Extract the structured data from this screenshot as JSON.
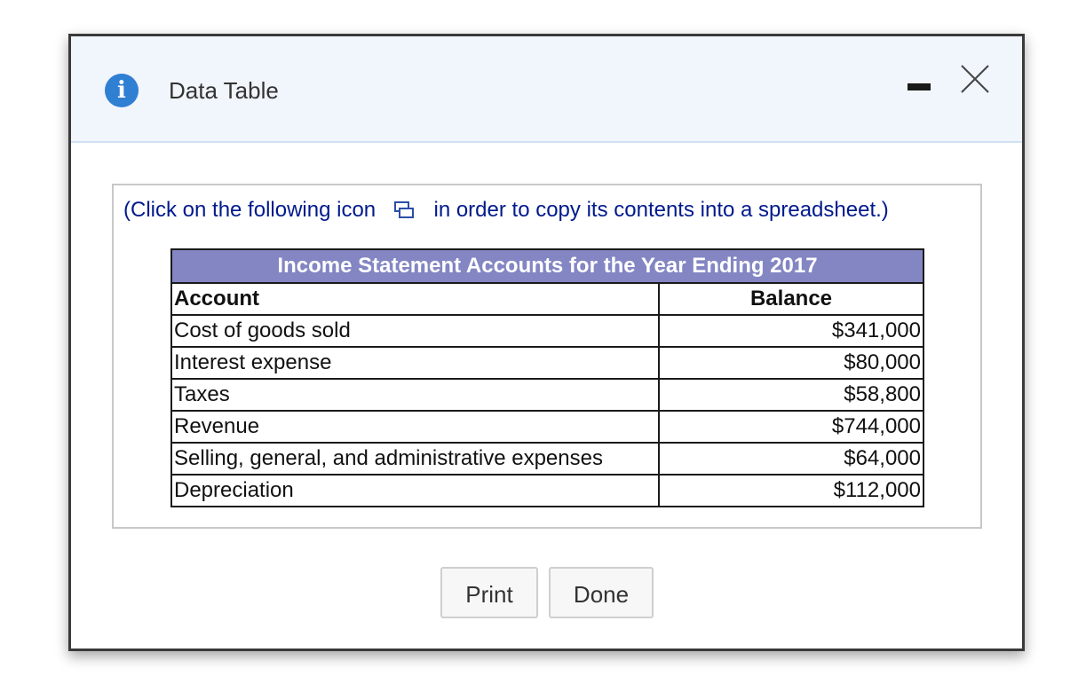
{
  "dialog": {
    "title": "Data Table",
    "icons": {
      "info": "info-icon",
      "info_glyph": "i",
      "minimize": "minimize-icon",
      "close": "close-icon",
      "copy": "copy-icon"
    }
  },
  "instruction": {
    "before_icon": "(Click on the following icon",
    "after_icon": "in order to copy its contents into a spreadsheet.)"
  },
  "table": {
    "caption": "Income Statement Accounts for the Year Ending 2017",
    "headers": {
      "account": "Account",
      "balance": "Balance"
    },
    "rows": [
      {
        "account": "Cost of goods sold",
        "balance": "$341,000"
      },
      {
        "account": "Interest expense",
        "balance": "$80,000"
      },
      {
        "account": "Taxes",
        "balance": "$58,800"
      },
      {
        "account": "Revenue",
        "balance": "$744,000"
      },
      {
        "account": "Selling, general, and administrative expenses",
        "balance": "$64,000"
      },
      {
        "account": "Depreciation",
        "balance": "$112,000"
      }
    ],
    "caption_color": "#8386c3"
  },
  "buttons": {
    "print_label": "Print",
    "done_label": "Done"
  },
  "colors": {
    "accent": "#2f7fd3",
    "instruction_text": "#001a8c",
    "titlebar_bg": "#f1f5fc"
  }
}
